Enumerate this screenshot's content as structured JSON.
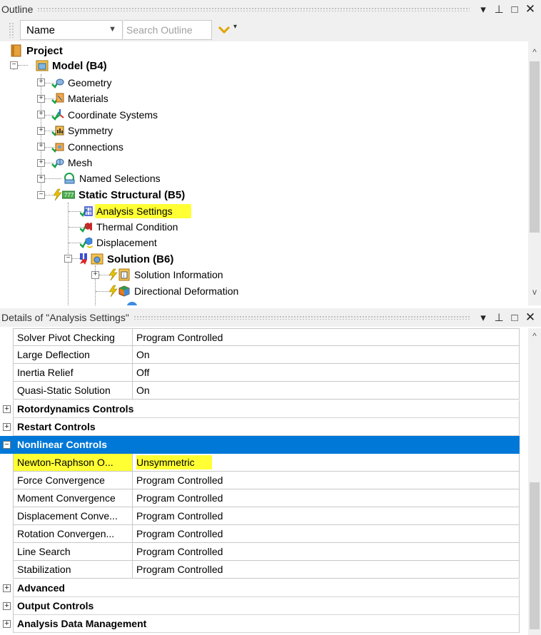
{
  "outline_panel": {
    "title": "Outline",
    "controls": {
      "dropdown": "▾",
      "pin": "⊥",
      "maximize": "□",
      "close": "✕"
    }
  },
  "toolbar": {
    "filter_by": "Name",
    "search_placeholder": "Search Outline"
  },
  "tree": {
    "project": "Project",
    "model": "Model (B4)",
    "geometry": "Geometry",
    "materials": "Materials",
    "coordinate_systems": "Coordinate Systems",
    "symmetry": "Symmetry",
    "connections": "Connections",
    "mesh": "Mesh",
    "named_selections": "Named Selections",
    "static_structural": "Static Structural (B5)",
    "analysis_settings": "Analysis Settings",
    "thermal_condition": "Thermal Condition",
    "displacement": "Displacement",
    "solution": "Solution (B6)",
    "solution_information": "Solution Information",
    "directional_deformation": "Directional Deformation"
  },
  "details_panel": {
    "title": "Details of \"Analysis Settings\"",
    "rows_top": [
      {
        "name": "Solver Pivot Checking",
        "value": "Program Controlled"
      },
      {
        "name": "Large Deflection",
        "value": "On"
      },
      {
        "name": "Inertia Relief",
        "value": "Off"
      },
      {
        "name": "Quasi-Static Solution",
        "value": "On"
      }
    ],
    "groups": {
      "rotordynamics": "Rotordynamics Controls",
      "restart": "Restart Controls",
      "nonlinear": "Nonlinear Controls",
      "advanced": "Advanced",
      "output": "Output Controls",
      "data_mgmt": "Analysis Data Management"
    },
    "nonlinear_rows": [
      {
        "name": "Newton-Raphson O...",
        "value": "Unsymmetric"
      },
      {
        "name": "Force Convergence",
        "value": "Program Controlled"
      },
      {
        "name": "Moment Convergence",
        "value": "Program Controlled"
      },
      {
        "name": "Displacement Conve...",
        "value": "Program Controlled"
      },
      {
        "name": "Rotation Convergen...",
        "value": "Program Controlled"
      },
      {
        "name": "Line Search",
        "value": "Program Controlled"
      },
      {
        "name": "Stabilization",
        "value": "Program Controlled"
      }
    ]
  },
  "colors": {
    "selection": "#0078d7",
    "highlight": "#ffff33",
    "check": "#16a34a",
    "lightning": "#e6c200"
  }
}
